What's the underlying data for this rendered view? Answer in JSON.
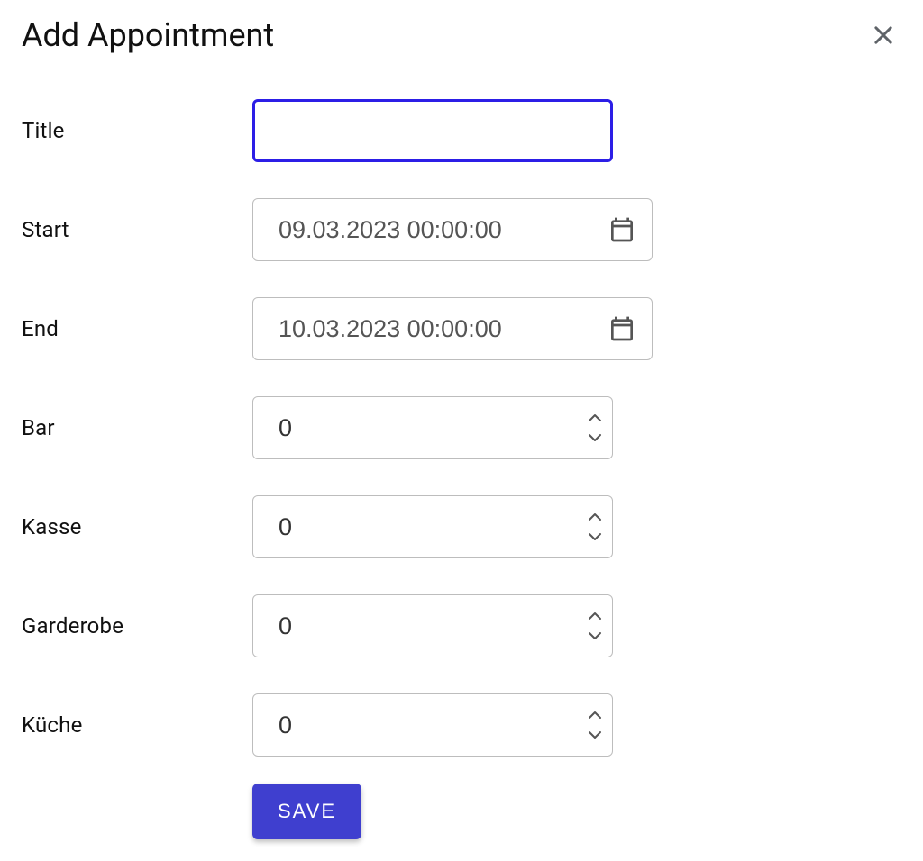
{
  "header": {
    "title": "Add Appointment"
  },
  "fields": {
    "title": {
      "label": "Title",
      "value": ""
    },
    "start": {
      "label": "Start",
      "value": "09.03.2023 00:00:00"
    },
    "end": {
      "label": "End",
      "value": "10.03.2023 00:00:00"
    },
    "bar": {
      "label": "Bar",
      "value": "0"
    },
    "kasse": {
      "label": "Kasse",
      "value": "0"
    },
    "garderobe": {
      "label": "Garderobe",
      "value": "0"
    },
    "kueche": {
      "label": "Küche",
      "value": "0"
    }
  },
  "actions": {
    "save_label": "SAVE"
  }
}
